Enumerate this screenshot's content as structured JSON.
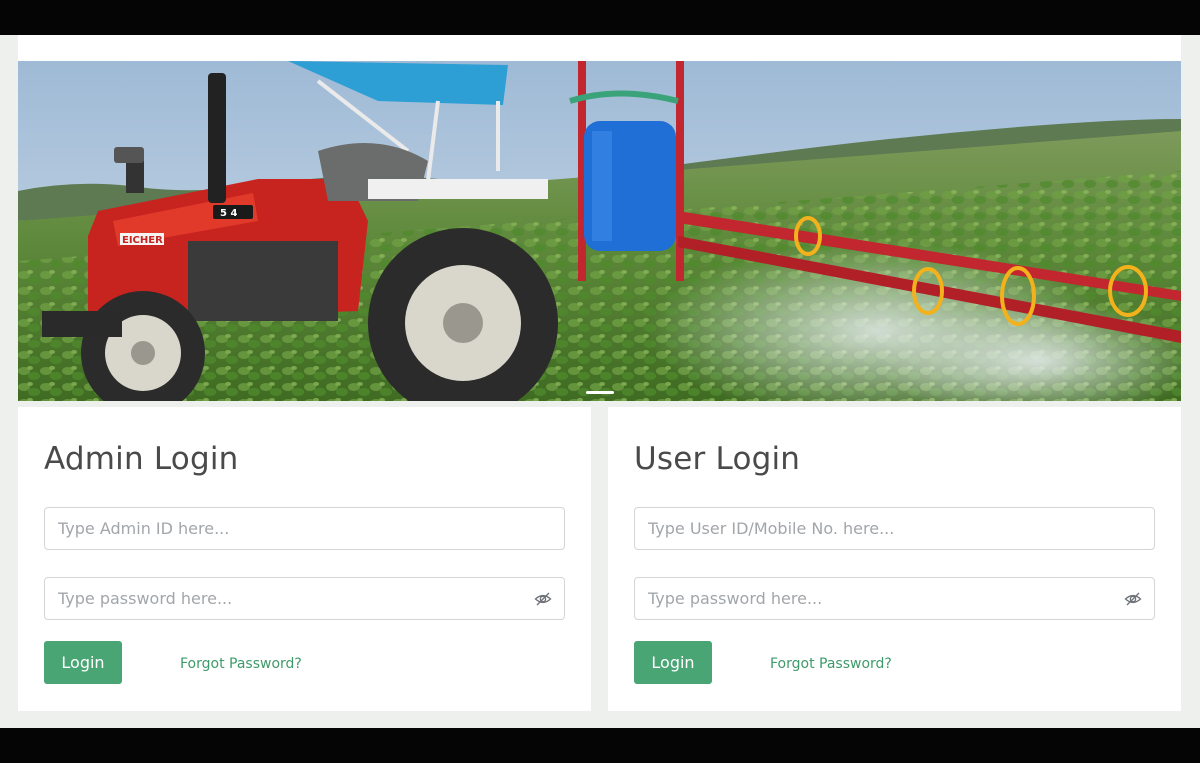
{
  "hero": {
    "image": "tractor-sprayer-field-photo",
    "brand_text": "EICHER",
    "model_text": "5 4"
  },
  "admin": {
    "title": "Admin Login",
    "id_placeholder": "Type Admin ID here...",
    "password_placeholder": "Type password here...",
    "login_label": "Login",
    "forgot_label": "Forgot Password?"
  },
  "user": {
    "title": "User Login",
    "id_placeholder": "Type User ID/Mobile No. here...",
    "password_placeholder": "Type password here...",
    "login_label": "Login",
    "forgot_label": "Forgot Password?"
  },
  "icons": {
    "password_toggle": "eye-slash-icon"
  },
  "colors": {
    "accent": "#4aa575",
    "link": "#3e9a6a",
    "page_bg": "#eef0ee"
  }
}
